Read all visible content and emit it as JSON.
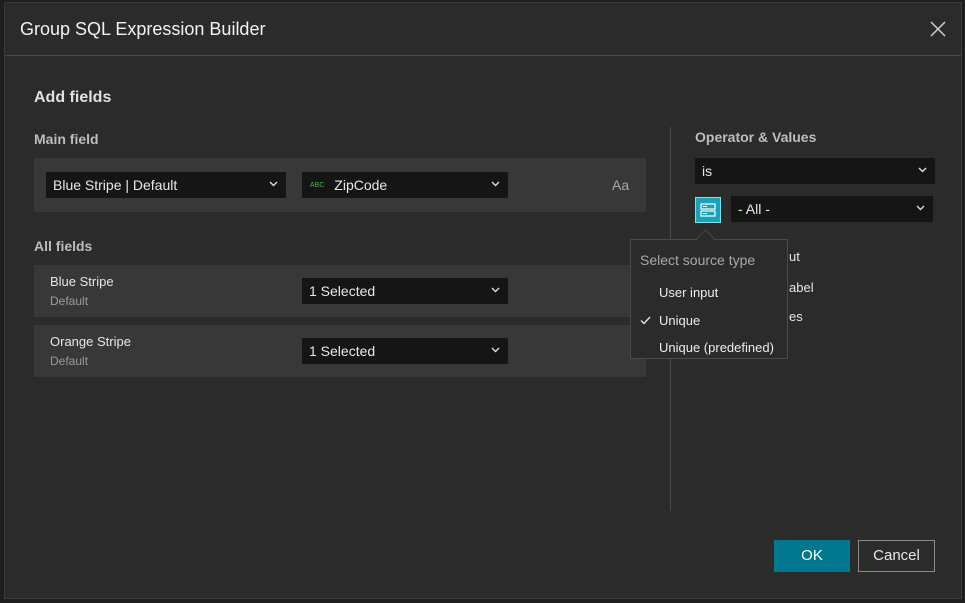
{
  "dialog": {
    "title": "Group SQL Expression Builder",
    "close_icon": "close-icon"
  },
  "add_fields": {
    "heading": "Add fields",
    "main_field": {
      "label": "Main field",
      "layer_select": "Blue Stripe | Default",
      "field_select": "ZipCode",
      "field_type_badge": "ABC",
      "case_toggle": "Aa"
    },
    "all_fields": {
      "label": "All fields",
      "rows": [
        {
          "name": "Blue Stripe",
          "sub": "Default",
          "select": "1 Selected"
        },
        {
          "name": "Orange Stripe",
          "sub": "Default",
          "select": "1 Selected"
        }
      ]
    }
  },
  "operator": {
    "label": "Operator & Values",
    "operator_select": "is",
    "value_select": "- All -",
    "partial_options": [
      "ut",
      "abel",
      "es"
    ]
  },
  "source_type_popover": {
    "title": "Select source type",
    "items": [
      {
        "label": "User input",
        "checked": false
      },
      {
        "label": "Unique",
        "checked": true
      },
      {
        "label": "Unique (predefined)",
        "checked": false
      }
    ]
  },
  "footer": {
    "ok_label": "OK",
    "cancel_label": "Cancel"
  },
  "colors": {
    "accent": "#00798f",
    "source_button": "#18a3b8",
    "field_type_badge": "#4caf50"
  }
}
